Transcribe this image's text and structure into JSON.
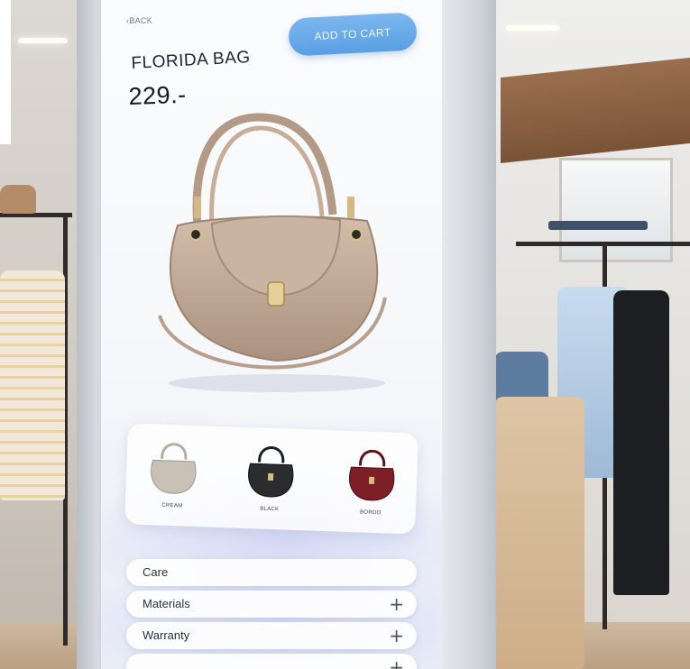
{
  "kiosk": {
    "back_label": "‹BACK",
    "add_to_cart_label": "ADD TO CART",
    "product": {
      "name": "FLORIDA BAG",
      "price": "229.-"
    },
    "variants": [
      {
        "label": "CREAM",
        "color": "#c9c1b6"
      },
      {
        "label": "BLACK",
        "color": "#2b2c2e"
      },
      {
        "label": "BORDO",
        "color": "#7c1f26"
      }
    ],
    "details": [
      {
        "label": "Care",
        "icon": "plus-icon"
      },
      {
        "label": "Materials",
        "icon": "plus-icon"
      },
      {
        "label": "Warranty",
        "icon": "plus-icon"
      }
    ],
    "accent_color": "#6aaae9",
    "hero_bag_color": "#c4ab98"
  }
}
